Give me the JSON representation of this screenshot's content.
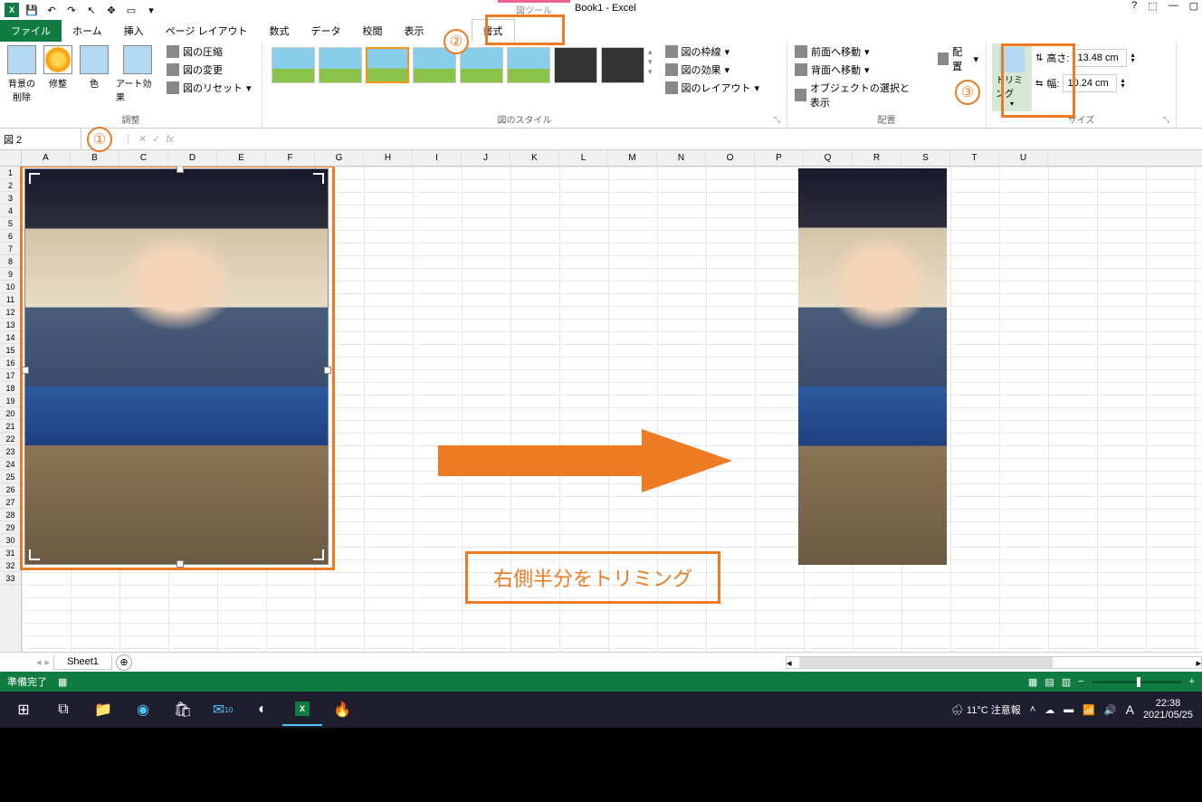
{
  "title": "Book1 - Excel",
  "pic_tools": "図ツール",
  "qat": {
    "save": "💾",
    "undo": "↶",
    "redo": "↷"
  },
  "win": {
    "help": "?",
    "opts": "⬚",
    "min": "—",
    "max": "▢"
  },
  "tabs": {
    "file": "ファイル",
    "home": "ホーム",
    "insert": "挿入",
    "layout": "ページ レイアウト",
    "formula": "数式",
    "data": "データ",
    "review": "校閲",
    "view": "表示",
    "format": "書式"
  },
  "ribbon": {
    "remove_bg": "背景の\n削除",
    "corrections": "修整",
    "color": "色",
    "effects": "アート効果",
    "compress": "図の圧縮",
    "change": "図の変更",
    "reset": "図のリセット",
    "adjust_group": "調整",
    "styles_group": "図のスタイル",
    "border": "図の枠線",
    "pic_effects": "図の効果",
    "pic_layout": "図のレイアウト",
    "bring_fwd": "前面へ移動",
    "send_back": "背面へ移動",
    "selection": "オブジェクトの選択と表示",
    "arrange_group": "配置",
    "align": "配置",
    "trim": "トリミング",
    "height_label": "高さ:",
    "width_label": "幅:",
    "height_val": "13.48 cm",
    "width_val": "10.24 cm",
    "size_group": "サイズ"
  },
  "name_box": "図 2",
  "columns": [
    "A",
    "B",
    "C",
    "D",
    "E",
    "F",
    "G",
    "H",
    "I",
    "J",
    "K",
    "L",
    "M",
    "N",
    "O",
    "P",
    "Q",
    "R",
    "S",
    "T",
    "U"
  ],
  "caption": "右側半分をトリミング",
  "annotations": {
    "c1": "①",
    "c2": "②",
    "c3": "③"
  },
  "sheet_tab": "Sheet1",
  "add_sheet": "⊕",
  "status": {
    "ready": "準備完了",
    "zoom_out": "−",
    "zoom_in": "+"
  },
  "taskbar": {
    "weather": "🌧 11°C 注意報",
    "time": "22:38",
    "date": "2021/05/25",
    "ime": "A"
  }
}
